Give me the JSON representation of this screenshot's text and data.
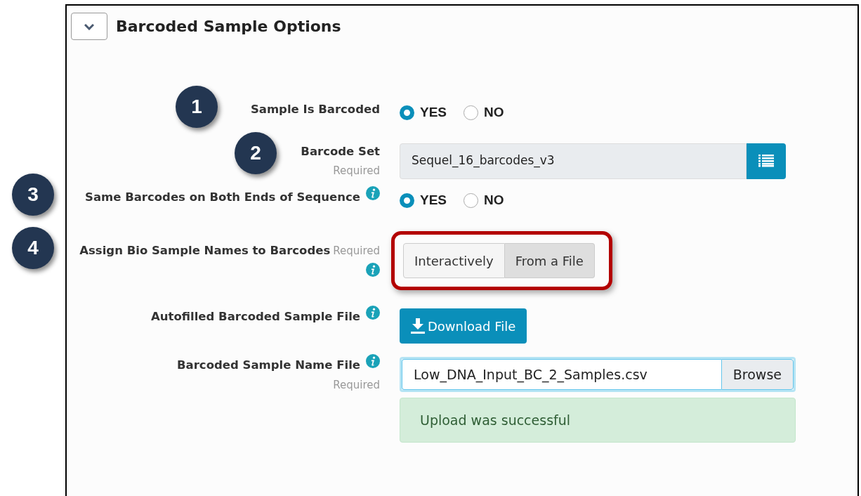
{
  "section": {
    "title": "Barcoded Sample Options",
    "expanded": true
  },
  "fields": [
    {
      "kind": "radio",
      "callout": "1",
      "label": "Sample Is Barcoded",
      "info": false,
      "options": [
        {
          "label": "YES",
          "selected": true
        },
        {
          "label": "NO",
          "selected": false
        }
      ]
    },
    {
      "kind": "select",
      "callout": "2",
      "label": "Barcode Set",
      "hint": "Required",
      "info": false,
      "value": "Sequel_16_barcodes_v3"
    },
    {
      "kind": "radio",
      "callout": "3",
      "label": "Same Barcodes on Both Ends of Sequence",
      "info": true,
      "options": [
        {
          "label": "YES",
          "selected": true
        },
        {
          "label": "NO",
          "selected": false
        }
      ]
    },
    {
      "kind": "toggle",
      "callout": "4",
      "label": "Assign Bio Sample Names to Barcodes",
      "hint": "Required",
      "info": true,
      "highlighted": true,
      "options": [
        {
          "label": "Interactively",
          "selected": false
        },
        {
          "label": "From a File",
          "selected": true
        }
      ]
    },
    {
      "kind": "download",
      "label": "Autofilled Barcoded Sample File",
      "info": true,
      "button": "Download File"
    },
    {
      "kind": "file",
      "label": "Barcoded Sample Name File",
      "hint": "Required",
      "info": true,
      "value": "Low_DNA_Input_BC_2_Samples.csv",
      "browse": "Browse",
      "message": "Upload was successful"
    }
  ]
}
